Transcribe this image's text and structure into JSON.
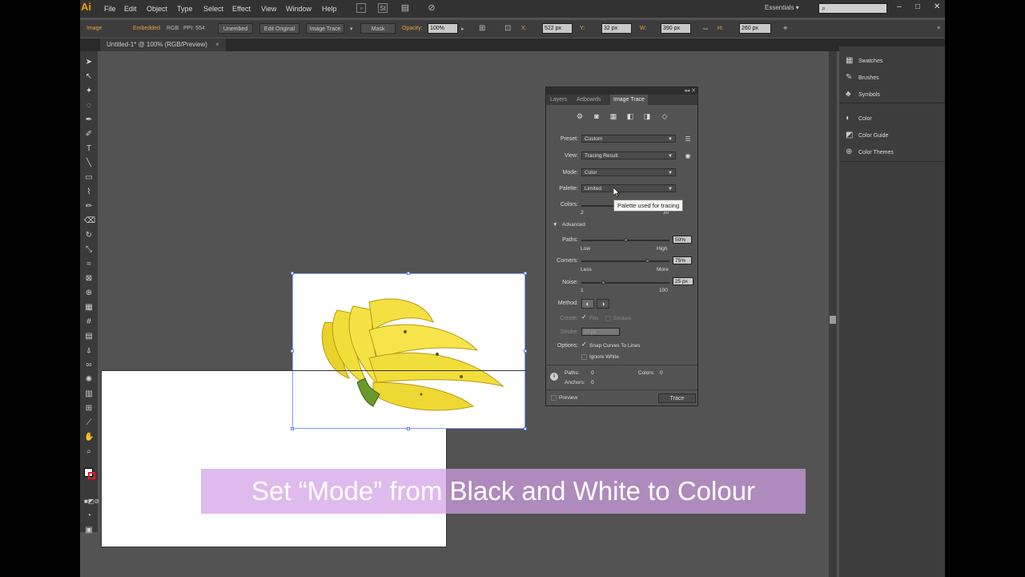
{
  "menubar": {
    "logo": "Ai",
    "items": [
      "File",
      "Edit",
      "Object",
      "Type",
      "Select",
      "Effect",
      "View",
      "Window",
      "Help"
    ],
    "workspace": "Essentials",
    "workspace_arrow": "▾",
    "window_controls": [
      "–",
      "□",
      "✕"
    ]
  },
  "control_bar": {
    "selection": "Image",
    "embedded": "Embedded",
    "color_mode": "RGB",
    "ppi": "PPI: 554",
    "unembed": "Unembed",
    "edit_original": "Edit Original",
    "image_trace": "Image Trace",
    "mask": "Mask",
    "opacity_label": "Opacity:",
    "opacity_value": "100%",
    "x_label": "X:",
    "x_value": "522 px",
    "y_label": "Y:",
    "y_value": "32 px",
    "w_label": "W:",
    "w_value": "390 px",
    "h_label": "H:",
    "h_value": "260 px"
  },
  "document_tab": {
    "title": "Untitled-1* @ 100% (RGB/Preview)",
    "close": "×"
  },
  "caption": "Set “Mode” from Black and White to Colour",
  "dock": {
    "items": [
      {
        "icon": "▦",
        "label": "Swatches"
      },
      {
        "icon": "✎",
        "label": "Brushes"
      },
      {
        "icon": "♣",
        "label": "Symbols"
      },
      {
        "icon": "◐",
        "label": "Color"
      },
      {
        "icon": "◩",
        "label": "Color Guide"
      },
      {
        "icon": "⊕",
        "label": "Color Themes"
      }
    ]
  },
  "image_trace_panel": {
    "tabs": [
      "Layers",
      "Artboards",
      "Image Trace"
    ],
    "top_controls": "◂◂ ✕",
    "preset_label": "Preset:",
    "preset_value": "Custom",
    "view_label": "View:",
    "view_value": "Tracing Result",
    "mode_label": "Mode:",
    "mode_value": "Color",
    "palette_label": "Palette:",
    "palette_value": "Limited",
    "colors_label": "Colors:",
    "colors_min": "2",
    "colors_max": "30",
    "advanced_label": "Advanced",
    "paths_label": "Paths:",
    "paths_value": "50%",
    "paths_fraction": 0.5,
    "paths_low": "Low",
    "paths_high": "High",
    "corners_label": "Corners:",
    "corners_value": "75%",
    "corners_fraction": 0.75,
    "corners_low": "Less",
    "corners_high": "More",
    "noise_label": "Noise:",
    "noise_value": "25 px",
    "noise_fraction": 0.25,
    "noise_min": "1",
    "noise_max": "100",
    "method_label": "Method:",
    "create_label": "Create:",
    "fills_label": "Fills",
    "strokes_label": "Strokes",
    "stroke_label": "Stroke:",
    "stroke_value": "10 px",
    "options_label": "Options:",
    "snap_label": "Snap Curves To Lines",
    "ignore_white_label": "Ignore White",
    "paths_stat_label": "Paths:",
    "paths_stat_value": "0",
    "anchors_stat_label": "Anchors:",
    "anchors_stat_value": "0",
    "colors_stat_label": "Colors:",
    "colors_stat_value": "0",
    "preview_label": "Preview",
    "trace_button": "Trace",
    "tooltip": "Palette used for tracing"
  },
  "colors": {
    "app_bg": "#535353",
    "accent": "#ff9a00",
    "caption_bg": "#d2a0e6",
    "selection": "#5b82e0",
    "banana": "#f2de3a"
  }
}
